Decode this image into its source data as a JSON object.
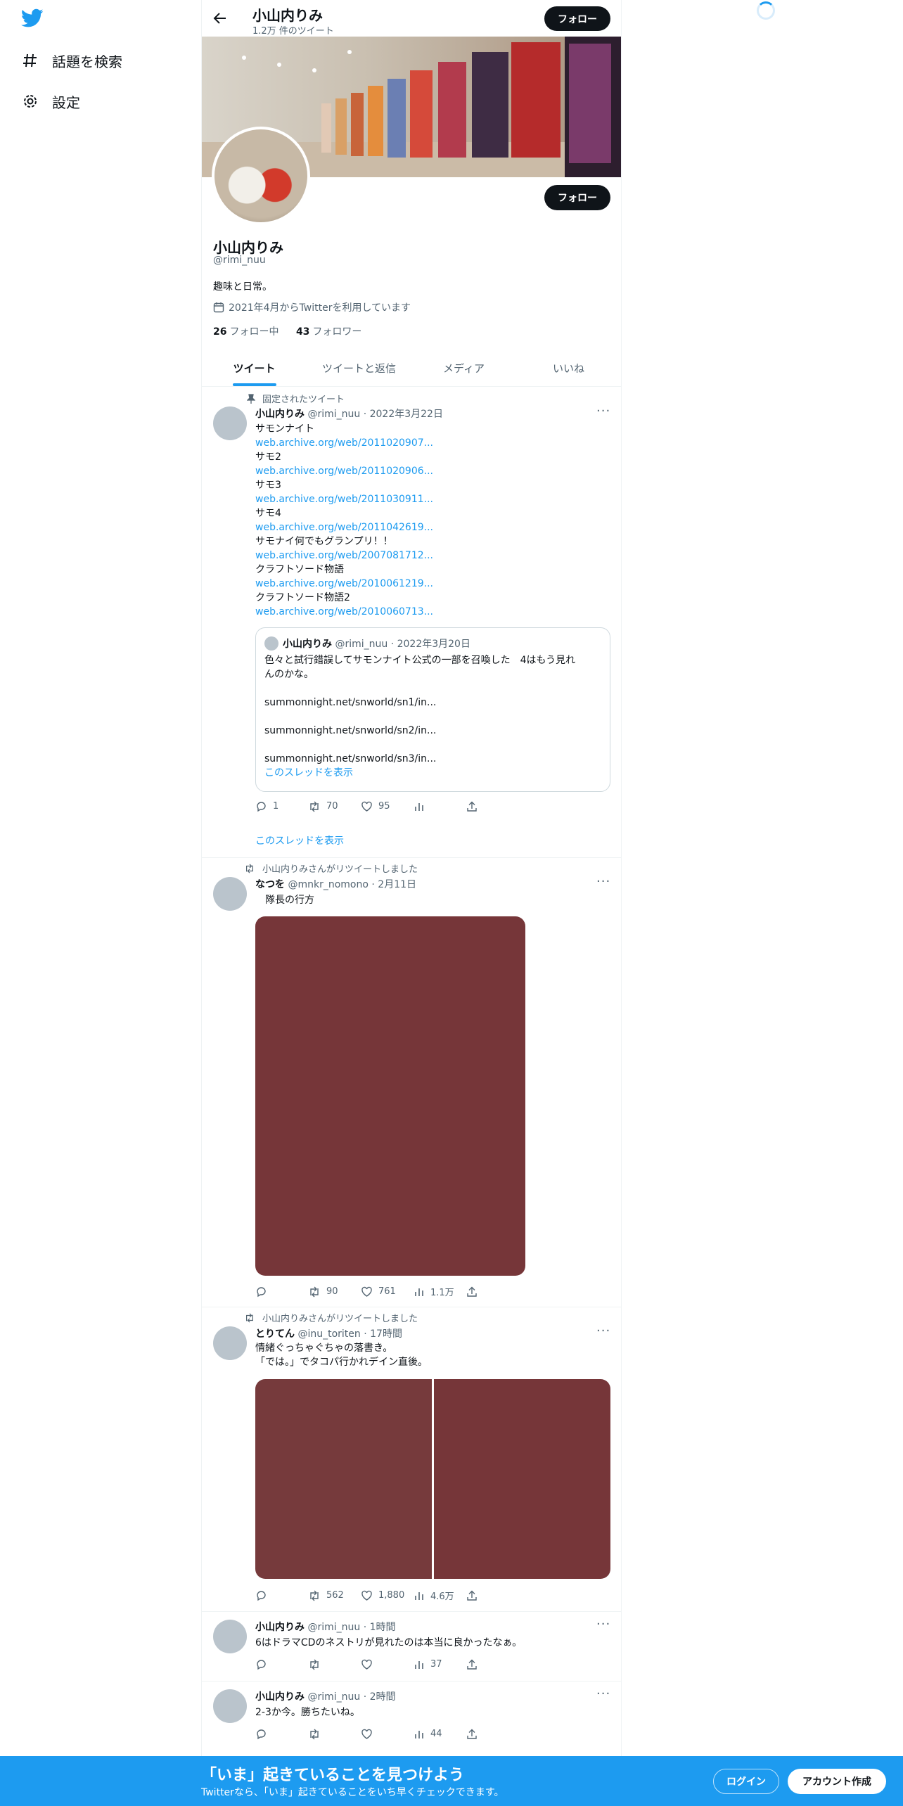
{
  "sidebar": {
    "explore_label": "話題を検索",
    "settings_label": "設定"
  },
  "header": {
    "name": "小山内りみ",
    "tweet_count": "1.2万 件のツイート",
    "follow_label": "フォロー"
  },
  "profile": {
    "name": "小山内りみ",
    "handle": "@rimi_nuu",
    "bio": "趣味と日常。",
    "joined": "2021年4月からTwitterを利用しています",
    "following_count": "26",
    "following_label": "フォロー中",
    "followers_count": "43",
    "followers_label": "フォロワー",
    "follow_label": "フォロー"
  },
  "tabs": [
    {
      "label": "ツイート",
      "active": true
    },
    {
      "label": "ツイートと返信",
      "active": false
    },
    {
      "label": "メディア",
      "active": false
    },
    {
      "label": "いいね",
      "active": false
    }
  ],
  "tweets": {
    "pinned": {
      "context": "固定されたツイート",
      "name": "小山内りみ",
      "handle": "@rimi_nuu",
      "date": "2022年3月22日",
      "lines": [
        {
          "text": "サモンナイト",
          "link": "web.archive.org/web/2011020907..."
        },
        {
          "text": "サモ2",
          "link": "web.archive.org/web/2011020906..."
        },
        {
          "text": "サモ3",
          "link": "web.archive.org/web/2011030911..."
        },
        {
          "text": "サモ4",
          "link": "web.archive.org/web/2011042619..."
        },
        {
          "text": "サモナイ何でもグランプリ！！",
          "link": "web.archive.org/web/2007081712..."
        },
        {
          "text": "クラフトソード物語",
          "link": "web.archive.org/web/2010061219..."
        },
        {
          "text": "クラフトソード物語2",
          "link": "web.archive.org/web/2010060713..."
        }
      ],
      "quote": {
        "name": "小山内りみ",
        "handle": "@rimi_nuu",
        "date": "2022年3月20日",
        "text1": "色々と試行錯誤してサモンナイト公式の一部を召喚した　4はもう見れ",
        "text2": "んのかな。",
        "link1": "summonnight.net/snworld/sn1/in...",
        "link2": "summonnight.net/snworld/sn2/in...",
        "link3": "summonnight.net/snworld/sn3/in...",
        "show_thread": "このスレッドを表示"
      },
      "replies": "1",
      "retweets": "70",
      "likes": "95",
      "show_thread": "このスレッドを表示"
    },
    "rt1": {
      "context": "小山内りみさんがリツイートしました",
      "name": "なつを",
      "handle": "@mnkr_nomono",
      "date": "2月11日",
      "text": "　隊長の行方",
      "replies": "",
      "retweets": "90",
      "likes": "761",
      "views": "1.1万"
    },
    "rt2": {
      "context": "小山内りみさんがリツイートしました",
      "name": "とりてん",
      "handle": "@inu_toriten",
      "date": "17時間",
      "text1": "情緒ぐっちゃぐちゃの落書き。",
      "text2": "「では。」でタコパ行かれデイン直後。",
      "retweets": "562",
      "likes": "1,880",
      "views": "4.6万"
    },
    "t4": {
      "name": "小山内りみ",
      "handle": "@rimi_nuu",
      "date": "1時間",
      "text": "6はドラマCDのネストリが見れたのは本当に良かったなぁ。",
      "views": "37"
    },
    "t5": {
      "name": "小山内りみ",
      "handle": "@rimi_nuu",
      "date": "2時間",
      "text": "2-3か今。勝ちたいね。",
      "views": "44"
    }
  },
  "bottom_bar": {
    "title": "「いま」起きていることを見つけよう",
    "subtitle": "Twitterなら、「いま」起きていることをいち早くチェックできます。",
    "login_label": "ログイン",
    "signup_label": "アカウント作成"
  },
  "colors": {
    "accent": "#1d9bf0",
    "media": "#763639"
  }
}
